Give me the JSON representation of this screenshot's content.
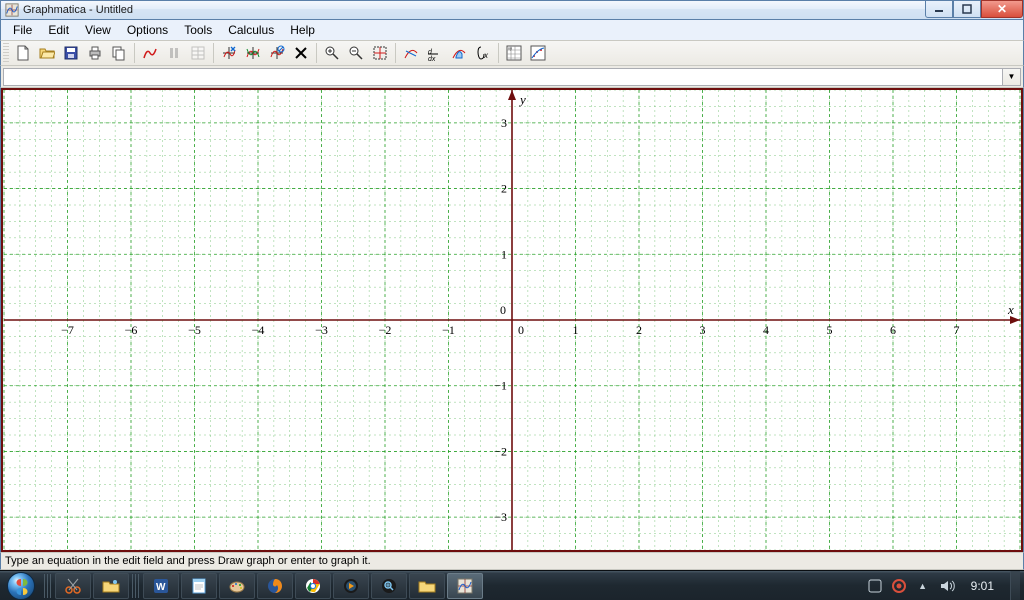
{
  "window": {
    "title": "Graphmatica - Untitled"
  },
  "menu": {
    "items": [
      "File",
      "Edit",
      "View",
      "Options",
      "Tools",
      "Calculus",
      "Help"
    ]
  },
  "toolbar": {
    "buttons": [
      "new-file-icon",
      "open-file-icon",
      "save-file-icon",
      "print-icon",
      "copy-icon",
      "sep",
      "draw-graph-icon",
      "pause-icon",
      "point-tables-icon",
      "sep",
      "clear-screen-icon",
      "redraw-all-icon",
      "hide-graph-icon",
      "delete-graph-icon",
      "sep",
      "zoom-in-icon",
      "zoom-out-icon",
      "set-range-icon",
      "sep",
      "tangent-line-icon",
      "derivative-icon",
      "integrate-icon",
      "find-point-icon",
      "sep",
      "data-plot-icon",
      "curve-fit-icon"
    ]
  },
  "formula": {
    "value": "",
    "placeholder": ""
  },
  "chart_data": {
    "type": "scatter",
    "title": "",
    "xlabel": "x",
    "ylabel": "y",
    "xlim": [
      -8,
      8
    ],
    "ylim": [
      -3.5,
      3.5
    ],
    "x_ticks": [
      -7,
      -6,
      -5,
      -4,
      -3,
      -2,
      -1,
      0,
      1,
      2,
      3,
      4,
      5,
      6,
      7
    ],
    "y_ticks": [
      -3,
      -2,
      -1,
      0,
      1,
      2,
      3
    ],
    "grid_minor": 0.25,
    "grid_major": 1,
    "series": []
  },
  "status": {
    "text": "Type an equation in the edit field and press Draw graph or enter to graph it."
  },
  "taskbar": {
    "items": [
      "snipping-tool-icon",
      "folder-sparkle-icon",
      "word-icon",
      "notepad-icon",
      "paint-icon",
      "firefox-icon",
      "chrome-icon",
      "media-icon",
      "magnifier-icon",
      "explorer-icon",
      "graphmatica-icon"
    ],
    "active_index": 10,
    "tray": {
      "icons": [
        "action-center-icon",
        "av-icon",
        "arrow-up-icon",
        "sound-icon"
      ],
      "clock": "9:01"
    }
  }
}
